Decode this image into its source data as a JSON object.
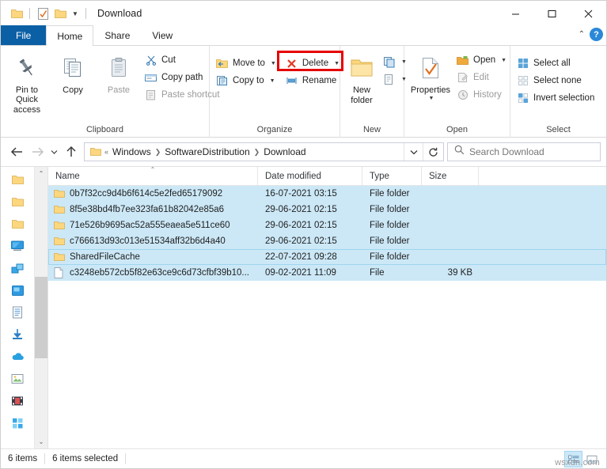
{
  "window": {
    "title": "Download",
    "quick_access": [
      "folder-icon",
      "properties-icon",
      "new-folder-icon"
    ],
    "controls": {
      "minimize": "minimize-icon",
      "maximize": "maximize-icon",
      "close": "close-icon"
    }
  },
  "ribbon": {
    "tabs": [
      {
        "label": "File",
        "active": false,
        "kind": "file"
      },
      {
        "label": "Home",
        "active": true,
        "kind": "normal"
      },
      {
        "label": "Share",
        "active": false,
        "kind": "normal"
      },
      {
        "label": "View",
        "active": false,
        "kind": "normal"
      }
    ],
    "collapse_icon": "chevron-up-icon",
    "help_label": "?",
    "groups": {
      "clipboard": {
        "label": "Clipboard",
        "pin": "Pin to Quick\naccess",
        "pin_line1": "Pin to Quick",
        "pin_line2": "access",
        "copy": "Copy",
        "paste": "Paste",
        "cut": "Cut",
        "copy_path": "Copy path",
        "paste_shortcut": "Paste shortcut"
      },
      "organize": {
        "label": "Organize",
        "move_to": "Move to",
        "copy_to": "Copy to",
        "delete": "Delete",
        "rename": "Rename",
        "highlighted": "delete"
      },
      "new": {
        "label": "New",
        "new_folder_line1": "New",
        "new_folder_line2": "folder",
        "new_item": "new-item-icon",
        "easy_access": "easy-access-icon"
      },
      "open": {
        "label": "Open",
        "properties": "Properties",
        "open": "Open",
        "edit": "Edit",
        "history": "History"
      },
      "select": {
        "label": "Select",
        "select_all": "Select all",
        "select_none": "Select none",
        "invert_selection": "Invert selection"
      }
    }
  },
  "navigation": {
    "back": "back-arrow-icon",
    "forward": "forward-arrow-icon",
    "recent": "chevron-down-icon",
    "up": "up-arrow-icon",
    "breadcrumb": [
      "Windows",
      "SoftwareDistribution",
      "Download"
    ],
    "breadcrumb_prefix": "«",
    "refresh": "refresh-icon",
    "search_placeholder": "Search Download",
    "search_icon": "search-icon"
  },
  "columns": [
    {
      "key": "name",
      "label": "Name",
      "sorted": true
    },
    {
      "key": "date",
      "label": "Date modified",
      "sorted": false
    },
    {
      "key": "type",
      "label": "Type",
      "sorted": false
    },
    {
      "key": "size",
      "label": "Size",
      "sorted": false
    }
  ],
  "files": [
    {
      "name": "0b7f32cc9d4b6f614c5e2fed65179092",
      "date": "16-07-2021 03:15",
      "type": "File folder",
      "size": "",
      "icon": "folder-icon",
      "selected": true,
      "focused": false
    },
    {
      "name": "8f5e38bd4fb7ee323fa61b82042e85a6",
      "date": "29-06-2021 02:15",
      "type": "File folder",
      "size": "",
      "icon": "folder-icon",
      "selected": true,
      "focused": false
    },
    {
      "name": "71e526b9695ac52a555eaea5e511ce60",
      "date": "29-06-2021 02:15",
      "type": "File folder",
      "size": "",
      "icon": "folder-icon",
      "selected": true,
      "focused": false
    },
    {
      "name": "c766613d93c013e51534aff32b6d4a40",
      "date": "29-06-2021 02:15",
      "type": "File folder",
      "size": "",
      "icon": "folder-icon",
      "selected": true,
      "focused": false
    },
    {
      "name": "SharedFileCache",
      "date": "22-07-2021 09:28",
      "type": "File folder",
      "size": "",
      "icon": "folder-icon",
      "selected": true,
      "focused": true
    },
    {
      "name": "c3248eb572cb5f82e63ce9c6d73cfbf39b10...",
      "date": "09-02-2021 11:09",
      "type": "File",
      "size": "39 KB",
      "icon": "file-icon",
      "selected": true,
      "focused": false
    }
  ],
  "nav_pane_icons": [
    "folder-icon",
    "folder-icon",
    "folder-icon",
    "this-pc-icon",
    "network-drive-icon",
    "drive-icon",
    "documents-icon",
    "downloads-icon",
    "onedrive-icon",
    "pictures-icon",
    "videos-icon",
    "apps-icon"
  ],
  "status": {
    "item_count": "6 items",
    "selected_count": "6 items selected",
    "view_details_icon": "details-view-icon",
    "view_large_icon": "large-icons-view-icon",
    "active_view": "details"
  },
  "watermark": "wsxdn.com",
  "colors": {
    "accent": "#0b5fa5",
    "selection": "#cce8f7",
    "highlight_box": "#e60000",
    "folder": "#ffd77a",
    "help": "#2b88d8"
  }
}
